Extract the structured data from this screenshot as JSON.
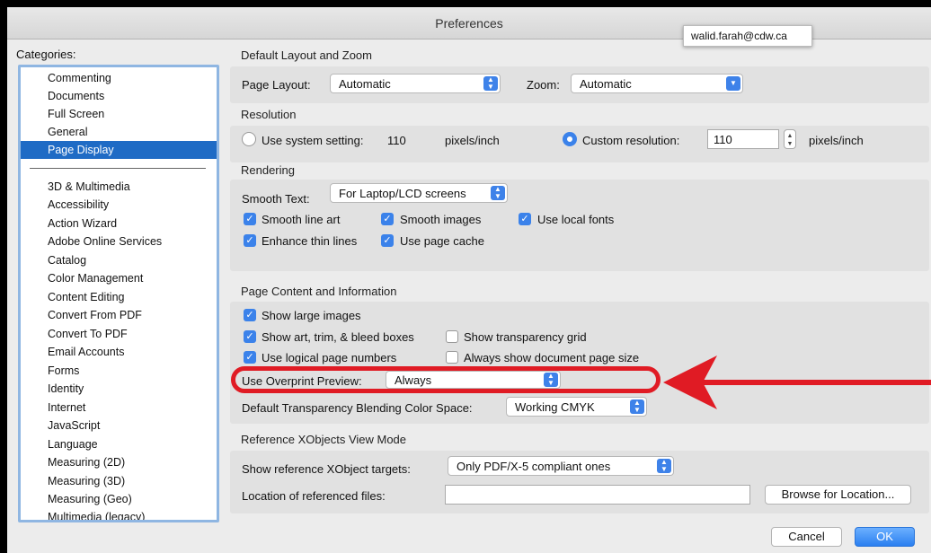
{
  "window": {
    "title": "Preferences"
  },
  "tooltip": {
    "email": "walid.farah@cdw.ca"
  },
  "categories": {
    "label": "Categories:",
    "top": [
      "Commenting",
      "Documents",
      "Full Screen",
      "General",
      "Page Display"
    ],
    "selected": "Page Display",
    "rest": [
      "3D & Multimedia",
      "Accessibility",
      "Action Wizard",
      "Adobe Online Services",
      "Catalog",
      "Color Management",
      "Content Editing",
      "Convert From PDF",
      "Convert To PDF",
      "Email Accounts",
      "Forms",
      "Identity",
      "Internet",
      "JavaScript",
      "Language",
      "Measuring (2D)",
      "Measuring (3D)",
      "Measuring (Geo)",
      "Multimedia (legacy)"
    ]
  },
  "layout_zoom": {
    "heading": "Default Layout and Zoom",
    "page_layout_label": "Page Layout:",
    "page_layout_value": "Automatic",
    "zoom_label": "Zoom:",
    "zoom_value": "Automatic"
  },
  "resolution": {
    "heading": "Resolution",
    "system_label": "Use system setting:",
    "system_value": "110",
    "system_unit": "pixels/inch",
    "system_checked": false,
    "custom_label": "Custom resolution:",
    "custom_value": "110",
    "custom_unit": "pixels/inch",
    "custom_checked": true
  },
  "rendering": {
    "heading": "Rendering",
    "smooth_text_label": "Smooth Text:",
    "smooth_text_value": "For Laptop/LCD screens",
    "options": [
      {
        "label": "Smooth line art",
        "checked": true
      },
      {
        "label": "Smooth images",
        "checked": true
      },
      {
        "label": "Use local fonts",
        "checked": true
      },
      {
        "label": "Enhance thin lines",
        "checked": true
      },
      {
        "label": "Use page cache",
        "checked": true
      }
    ]
  },
  "page_content": {
    "heading": "Page Content and Information",
    "options": [
      {
        "label": "Show large images",
        "checked": true
      },
      {
        "label": "Show art, trim, & bleed boxes",
        "checked": true
      },
      {
        "label": "Show transparency grid",
        "checked": false
      },
      {
        "label": "Use logical page numbers",
        "checked": true
      },
      {
        "label": "Always show document page size",
        "checked": false
      }
    ],
    "overprint_label": "Use Overprint Preview:",
    "overprint_value": "Always",
    "blend_label": "Default Transparency Blending Color Space:",
    "blend_value": "Working CMYK"
  },
  "xobjects": {
    "heading": "Reference XObjects View Mode",
    "targets_label": "Show reference XObject targets:",
    "targets_value": "Only PDF/X-5 compliant ones",
    "location_label": "Location of referenced files:",
    "location_value": "",
    "browse_label": "Browse for Location..."
  },
  "footer": {
    "cancel_label": "Cancel",
    "ok_label": "OK"
  },
  "colors": {
    "accent": "#3b82ea",
    "selection": "#1f6bc5",
    "annotation_red": "#e01b24"
  },
  "icons": {
    "popup": "updown-chevron-icon",
    "check": "checkmark-icon",
    "arrow": "red-arrow-annotation"
  }
}
